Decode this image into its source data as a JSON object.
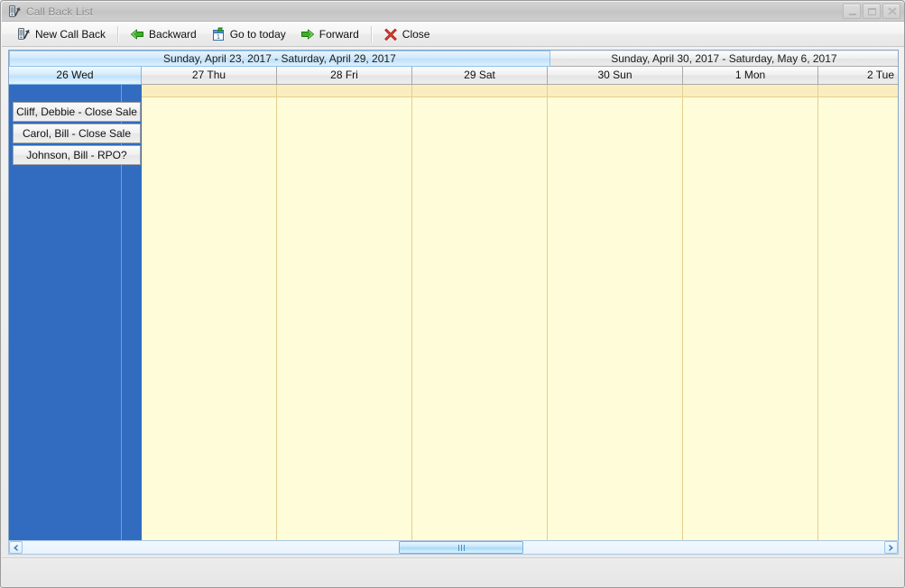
{
  "window": {
    "title": "Call Back List",
    "title_icon": "callback-icon",
    "controls": {
      "minimize": "Minimize",
      "maximize": "Maximize",
      "close": "Close"
    }
  },
  "toolbar": {
    "items": [
      {
        "label": "New Call Back",
        "icon": "new-call-back-icon"
      },
      {
        "label": "Backward",
        "icon": "green-left-arrow-icon"
      },
      {
        "label": "Go to today",
        "icon": "calendar-today-icon"
      },
      {
        "label": "Forward",
        "icon": "green-right-arrow-icon"
      },
      {
        "label": "Close",
        "icon": "red-x-icon"
      }
    ]
  },
  "calendar": {
    "weeks": [
      {
        "label": "Sunday, April 23, 2017 - Saturday, April 29, 2017",
        "selected": true
      },
      {
        "label": "Sunday, April 30, 2017 - Saturday, May 6, 2017",
        "selected": false
      }
    ],
    "days": [
      {
        "label": "26 Wed",
        "selected": true
      },
      {
        "label": "27 Thu",
        "selected": false
      },
      {
        "label": "28 Fri",
        "selected": false
      },
      {
        "label": "29 Sat",
        "selected": false
      },
      {
        "label": "30 Sun",
        "selected": false
      },
      {
        "label": "1 Mon",
        "selected": false
      },
      {
        "label": "2 Tue",
        "selected": false
      }
    ],
    "appointments": [
      {
        "text": "Cliff, Debbie - Close Sale",
        "day": "26 Wed"
      },
      {
        "text": "Carol, Bill - Close Sale",
        "day": "26 Wed"
      },
      {
        "text": "Johnson, Bill - RPO?",
        "day": "26 Wed"
      }
    ],
    "colors": {
      "selected_day_fill": "#316cc0",
      "day_fill": "#fefcd9",
      "all_day_fill": "#faeec0",
      "grid_line": "#e3cf8f",
      "header_selected": "#bfe2fb"
    }
  },
  "scrollbar": {
    "left_arrow": "scroll-left-arrow",
    "right_arrow": "scroll-right-arrow",
    "thumb": "horizontal-scroll-thumb"
  }
}
